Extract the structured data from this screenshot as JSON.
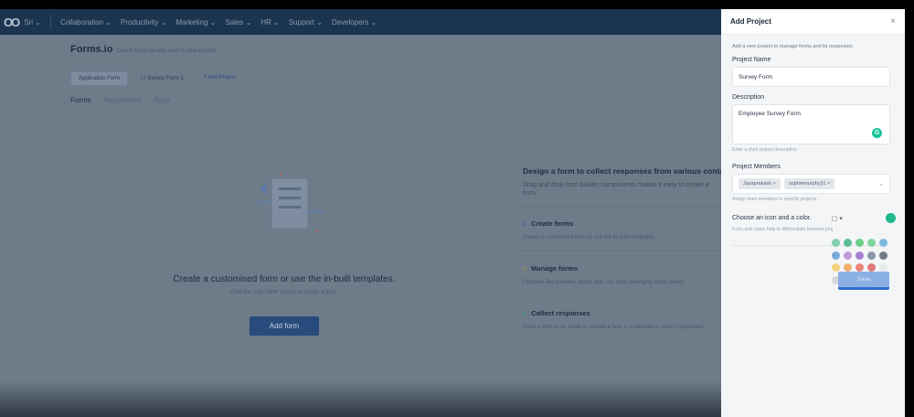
{
  "nav": {
    "logo": "OO",
    "app": "Sri",
    "items": [
      "Collaboration",
      "Productivity",
      "Marketing",
      "Sales",
      "HR",
      "Support",
      "Developers"
    ]
  },
  "header": {
    "title": "Forms.io",
    "subtitle": "Create forms people want to interact with."
  },
  "projects": [
    {
      "label": "Application Form"
    },
    {
      "label": "Survey Form 1"
    }
  ],
  "add_project_link": "+ Add Project",
  "tabs": [
    "Forms",
    "Responses",
    "Apps"
  ],
  "empty": {
    "title": "Create a customised form or use the in-built templates.",
    "subtitle": "Click the 'Add Form' button to design a form.",
    "button": "Add form"
  },
  "info": {
    "title": "Design a form to collect responses from various contacts",
    "subtitle": "Drag and drop form builder components makes it easy to create a form.",
    "features": [
      {
        "title": "Create forms",
        "desc": "Create a customised form or use the in-built templates.",
        "color": "#3a64a8"
      },
      {
        "title": "Manage forms",
        "desc": "Features like preview, share, edit, etc. help managing forms easily.",
        "color": "#a8903a"
      },
      {
        "title": "Collect responses",
        "desc": "Send a form to an email or embed a form in a website to collect responses.",
        "color": "#2aa07a"
      }
    ]
  },
  "panel": {
    "title": "Add Project",
    "close": "×",
    "description": "Add a new project to manage forms and its responses.",
    "name_label": "Project Name",
    "name_value": "Survey Form",
    "desc_label": "Description",
    "desc_value": "Employee Survey Form",
    "desc_hint": "Enter a short project description.",
    "members_label": "Project Members",
    "members": [
      "Jayaprakash",
      "sophiemurphy31"
    ],
    "members_hint": "Assign team members to specific projects.",
    "icon_label": "Choose an icon and a color.",
    "icon_hint": "Icons and colors help to differentiate between projects.",
    "selected_color": "#1fb98a",
    "save": "Save",
    "palette": [
      "#7fcfae",
      "#5cbf94",
      "#6dcf8a",
      "#7fd49a",
      "#7ab8e0",
      "#7aa8d8",
      "#c09ad8",
      "#a680d0",
      "#8a96a6",
      "#737b86",
      "#f2d27a",
      "#f2b070",
      "#ec857a",
      "#df7878",
      "#e8eaec",
      "#d6d8db"
    ]
  }
}
